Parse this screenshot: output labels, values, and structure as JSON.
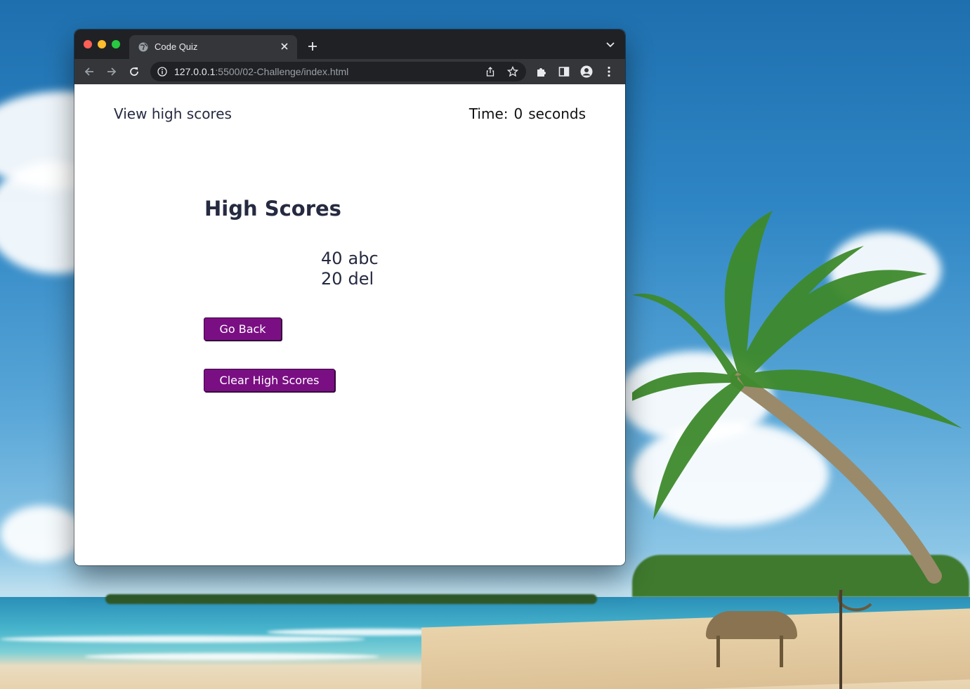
{
  "browser": {
    "tab_title": "Code Quiz",
    "url_host": "127.0.0.1",
    "url_rest": ":5500/02-Challenge/index.html"
  },
  "page": {
    "view_high_scores_link": "View high scores",
    "timer_label": "Time:",
    "timer_value": "0",
    "timer_unit": "seconds",
    "heading": "High Scores",
    "scores": [
      {
        "score": "40",
        "initials": "abc"
      },
      {
        "score": "20",
        "initials": "del"
      }
    ],
    "go_back_button": "Go Back",
    "clear_button": "Clear High Scores"
  },
  "colors": {
    "button_bg": "#7a0f83",
    "text_dark": "#262a41"
  }
}
